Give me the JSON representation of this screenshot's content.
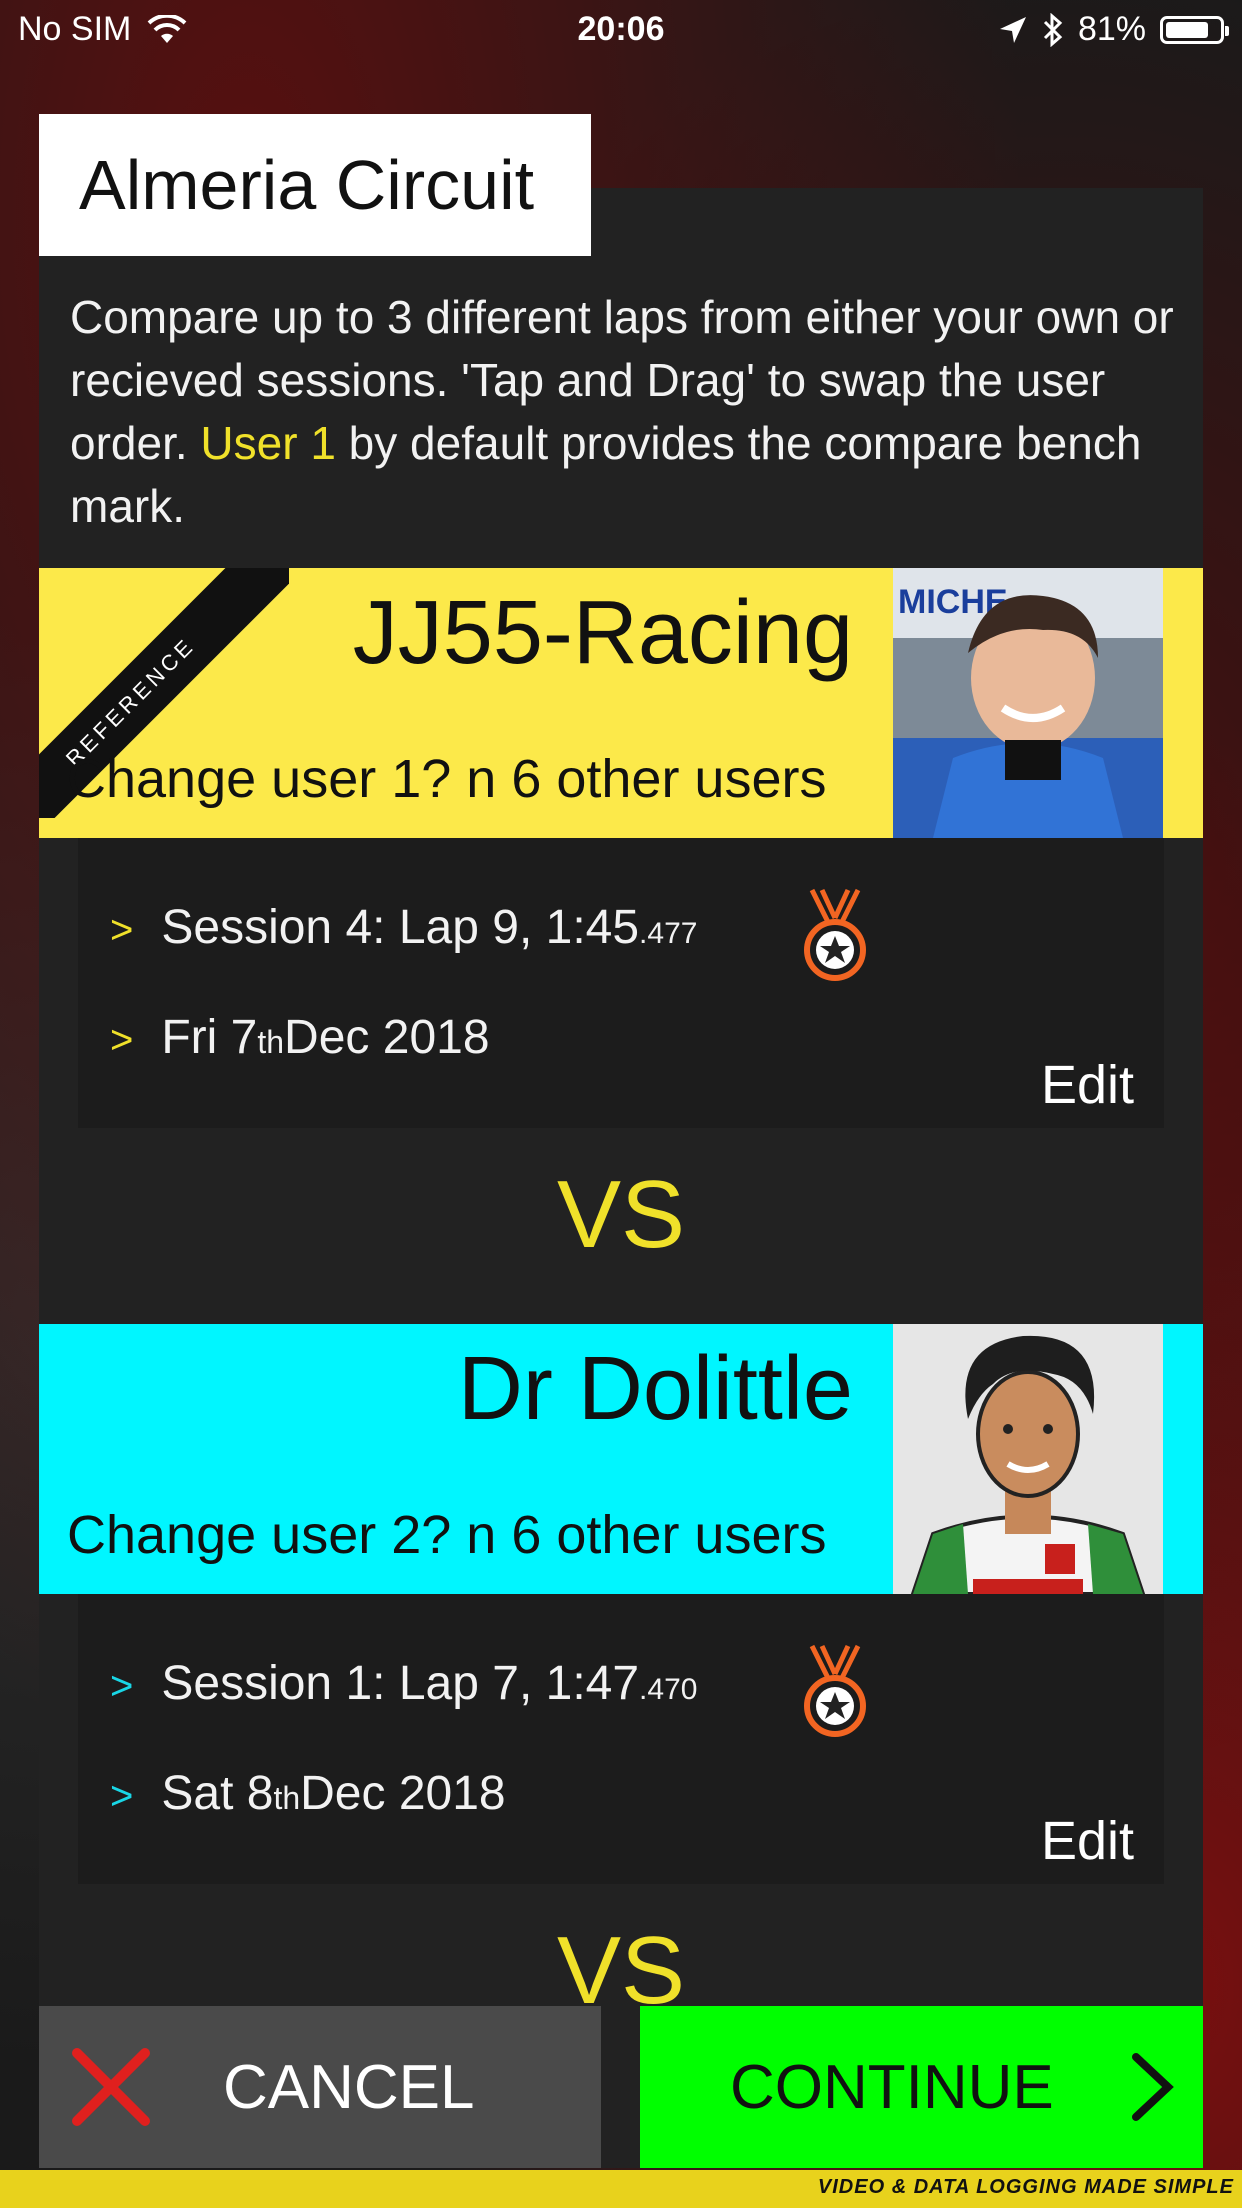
{
  "status_bar": {
    "carrier": "No SIM",
    "time": "20:06",
    "battery": "81%",
    "battery_level": 0.81
  },
  "header": {
    "title": "Almeria Circuit"
  },
  "intro": {
    "text_before": "Compare up to 3 different laps from either your own or recieved sessions.  'Tap and Drag' to swap the user order.  ",
    "highlight": "User 1",
    "text_after": " by default provides the compare bench mark."
  },
  "users": [
    {
      "name": "JJ55-Racing",
      "badge": "REFERENCE",
      "change_label": "Change user 1? n 6 other users",
      "color": "#fce94a",
      "chevron_color": "#f0e12a",
      "session_main": "Session 4: Lap 9, 1:45",
      "session_ms": ".477",
      "date_day": "Fri 7",
      "date_suffix": "th",
      "date_rest": " Dec 2018",
      "edit_label": "Edit"
    },
    {
      "name": "Dr Dolittle",
      "change_label": "Change user 2? n 6 other users",
      "color": "#00f6ff",
      "chevron_color": "#19d6e6",
      "session_main": "Session 1: Lap 7, 1:47",
      "session_ms": ".470",
      "date_day": "Sat 8",
      "date_suffix": "th",
      "date_rest": " Dec 2018",
      "edit_label": "Edit"
    }
  ],
  "vs_label": "VS",
  "buttons": {
    "cancel": "CANCEL",
    "continue": "CONTINUE"
  },
  "footer": {
    "tagline": "VIDEO & DATA LOGGING MADE SIMPLE"
  },
  "colors": {
    "accent_yellow": "#f0e12a",
    "medal": "#f26522",
    "cancel_x": "#e0201e",
    "continue_bg": "#00ff00"
  }
}
